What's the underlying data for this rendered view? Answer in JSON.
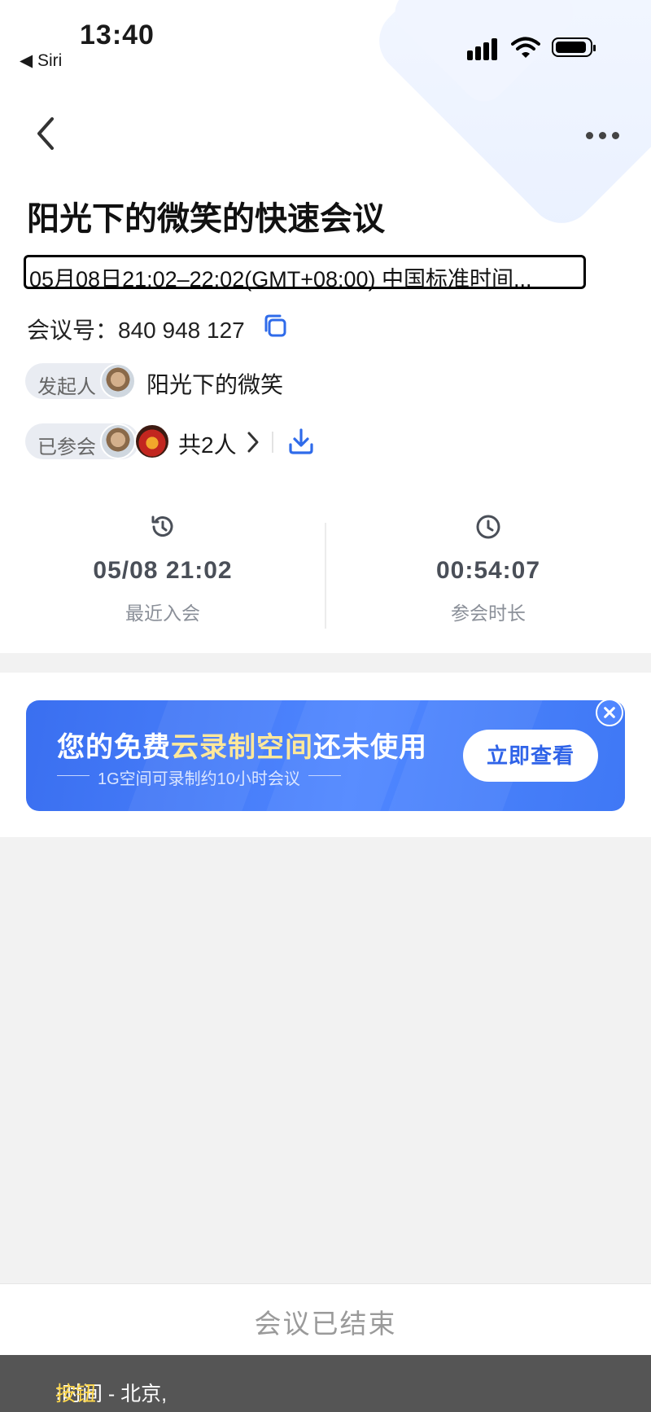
{
  "status_bar": {
    "time": "13:40",
    "back_app": "◀ Siri"
  },
  "meeting": {
    "title": "阳光下的微笑的快速会议",
    "time_range": "05月08日21:02–22:02(GMT+08:00) 中国标准时间...",
    "id_label": "会议号：",
    "id_value": "840 948 127"
  },
  "host": {
    "tag": "发起人",
    "name": "阳光下的微笑"
  },
  "participants": {
    "tag": "已参会",
    "count": "共2人"
  },
  "stats": [
    {
      "icon": "history-clock-icon",
      "value": "05/08 21:02",
      "label": "最近入会"
    },
    {
      "icon": "clock-icon",
      "value": "00:54:07",
      "label": "参会时长"
    }
  ],
  "banner": {
    "headline_part1": "您的免费",
    "headline_highlight": "云录制空间",
    "headline_part2": "还未使用",
    "subtitle": "1G空间可录制约10小时会议",
    "button": "立即查看"
  },
  "footer": {
    "status": "会议已结束"
  },
  "voiceover": {
    "text": "⁝时间 - 北京, ",
    "highlight": "按钮"
  },
  "colors": {
    "accent": "#2f6bea",
    "banner_highlight": "#ffe89a",
    "background": "#f2f2f2"
  }
}
